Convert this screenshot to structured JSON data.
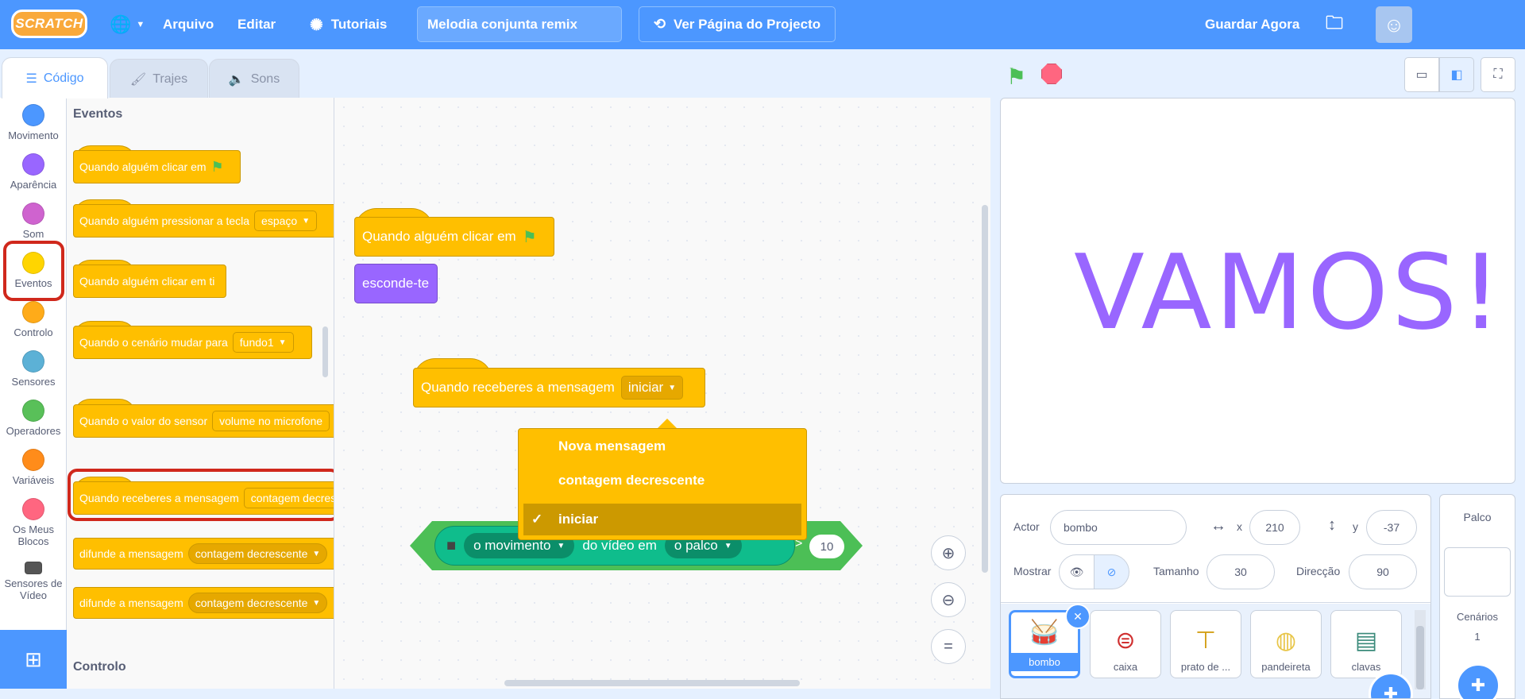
{
  "menubar": {
    "logo": "SCRATCH",
    "language_icon": "globe-icon",
    "file": "Arquivo",
    "edit": "Editar",
    "tutorials": "Tutoriais",
    "project_title": "Melodia conjunta remix",
    "project_page": "Ver Página do Projecto",
    "save_now": "Guardar Agora"
  },
  "tabs": {
    "code": "Código",
    "costumes": "Trajes",
    "sounds": "Sons"
  },
  "categories": [
    {
      "label": "Movimento",
      "color": "#4c97ff"
    },
    {
      "label": "Aparência",
      "color": "#9966ff"
    },
    {
      "label": "Som",
      "color": "#cf63cf"
    },
    {
      "label": "Eventos",
      "color": "#ffd500"
    },
    {
      "label": "Controlo",
      "color": "#ffab19"
    },
    {
      "label": "Sensores",
      "color": "#5cb1d6"
    },
    {
      "label": "Operadores",
      "color": "#59c059"
    },
    {
      "label": "Variáveis",
      "color": "#ff8c1a"
    },
    {
      "label": "Os Meus Blocos",
      "color": "#ff6680"
    },
    {
      "label": "Sensores de Vídeo",
      "color": "#0fbd8c"
    }
  ],
  "palette": {
    "heading": "Eventos",
    "next_heading": "Controlo",
    "b1": "Quando alguém clicar em",
    "b2": "Quando alguém pressionar a tecla",
    "b2_key": "espaço",
    "b3": "Quando alguém clicar em ti",
    "b4": "Quando o cenário mudar para",
    "b4_val": "fundo1",
    "b5": "Quando o valor do sensor",
    "b5_val": "volume no microfone",
    "b6": "Quando receberes a mensagem",
    "b6_val": "contagem decrescente",
    "b7": "difunde a mensagem",
    "b7_val": "contagem decrescente",
    "b8": "difunde a mensagem",
    "b8_val": "contagem decrescente"
  },
  "workspace": {
    "s1_hat": "Quando alguém clicar em",
    "s1_hide": "esconde-te",
    "s2_hat": "Quando receberes a mensagem",
    "s2_val": "iniciar",
    "menu": [
      "Nova mensagem",
      "contagem decrescente",
      "iniciar"
    ],
    "menu_checked": "iniciar",
    "video_prop": "o movimento",
    "video_text": "do vídeo em",
    "video_target": "o palco",
    "gt": ">",
    "threshold": "10"
  },
  "stage": {
    "text": "VAMOS!"
  },
  "sprite_info": {
    "actor_label": "Actor",
    "actor_name": "bombo",
    "x_label": "x",
    "x_value": "210",
    "y_label": "y",
    "y_value": "-37",
    "show_label": "Mostrar",
    "size_label": "Tamanho",
    "size_value": "30",
    "direction_label": "Direcção",
    "direction_value": "90"
  },
  "sprites": [
    "bombo",
    "caixa",
    "prato de ...",
    "pandeireta",
    "clavas"
  ],
  "stage_pane": {
    "title": "Palco",
    "backdrops_label": "Cenários",
    "backdrops_count": "1"
  }
}
